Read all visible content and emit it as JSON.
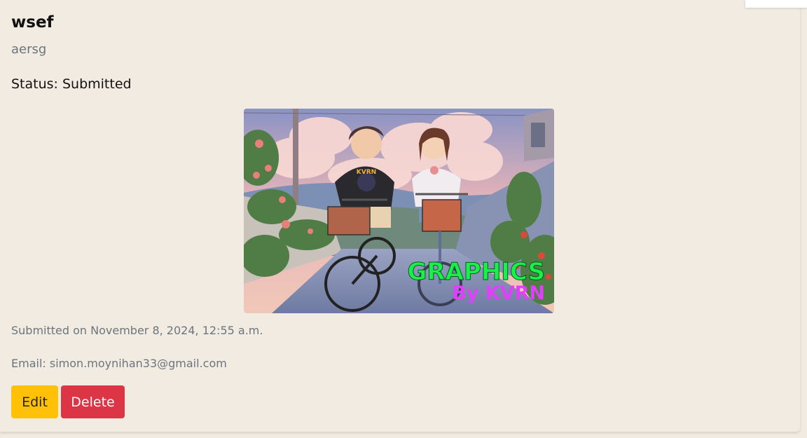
{
  "submission": {
    "title": "wsef",
    "description": "aersg",
    "status_text": "Status: Submitted",
    "image": {
      "overlay_line1": "GRAPHICS",
      "overlay_line2": "By KVRN",
      "shirt_text": "KVRN"
    },
    "submitted_text": "Submitted on November 8, 2024, 12:55 a.m.",
    "email_text": "Email: simon.moynihan33@gmail.com"
  },
  "actions": {
    "edit_label": "Edit",
    "delete_label": "Delete"
  },
  "colors": {
    "background": "#f2ebe2",
    "edit": "#ffc107",
    "delete": "#dc3545",
    "muted": "#6c757d",
    "overlay_green": "#19f04a",
    "overlay_magenta": "#e040fb"
  }
}
